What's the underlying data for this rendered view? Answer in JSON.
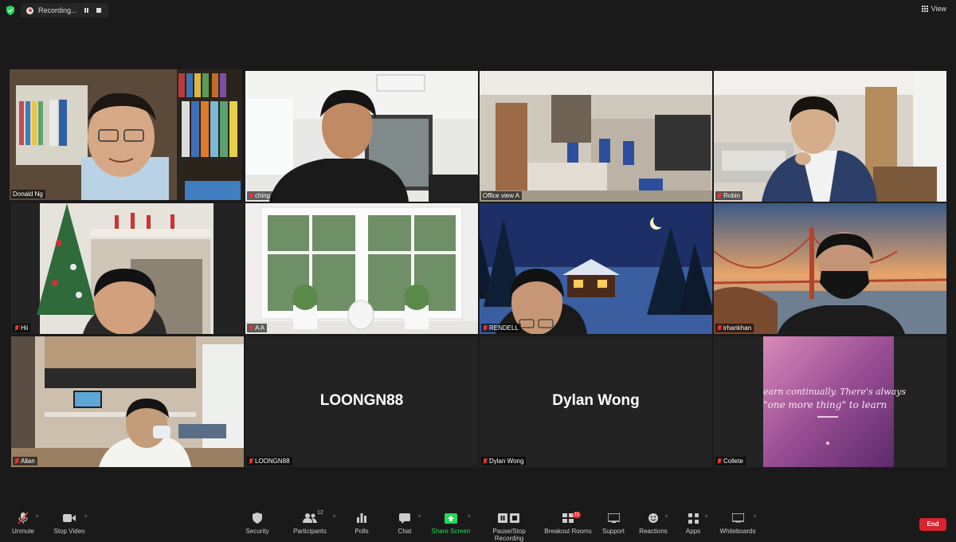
{
  "recording": {
    "label": "Recording..."
  },
  "view": {
    "label": "View"
  },
  "participants": [
    {
      "name": "Donald Ng",
      "display": "video",
      "active": true
    },
    {
      "name": "ching",
      "display": "video"
    },
    {
      "name": "Office view A",
      "display": "video"
    },
    {
      "name": "Robin",
      "display": "video"
    },
    {
      "name": "Hii",
      "display": "video"
    },
    {
      "name": "A A",
      "display": "video"
    },
    {
      "name": "RENDELL",
      "display": "video"
    },
    {
      "name": "irhankhan",
      "display": "video"
    },
    {
      "name": "Allan",
      "display": "video"
    },
    {
      "name": "LOONGN88",
      "display": "name-only"
    },
    {
      "name": "Dylan Wong",
      "display": "name-only"
    },
    {
      "name": "Collete",
      "display": "video"
    }
  ],
  "collete_quote": {
    "line1": "earn continually. There's always",
    "line2": "\"one more thing\" to learn"
  },
  "toolbar": {
    "unmute": "Unmute",
    "stop_video": "Stop Video",
    "security": "Security",
    "participants": "Participants",
    "participants_count": "12",
    "polls": "Polls",
    "chat": "Chat",
    "share_screen": "Share Screen",
    "pause_recording": "Pause/Stop Recording",
    "breakout_rooms": "Breakout Rooms",
    "breakout_badge": "11",
    "support": "Support",
    "reactions": "Reactions",
    "apps": "Apps",
    "whiteboards": "Whiteboards",
    "end": "End"
  },
  "colors": {
    "active_speaker_border": "#c6e36b",
    "share_green": "#23d959",
    "end_red": "#d9232f",
    "muted_red": "#e33333"
  }
}
